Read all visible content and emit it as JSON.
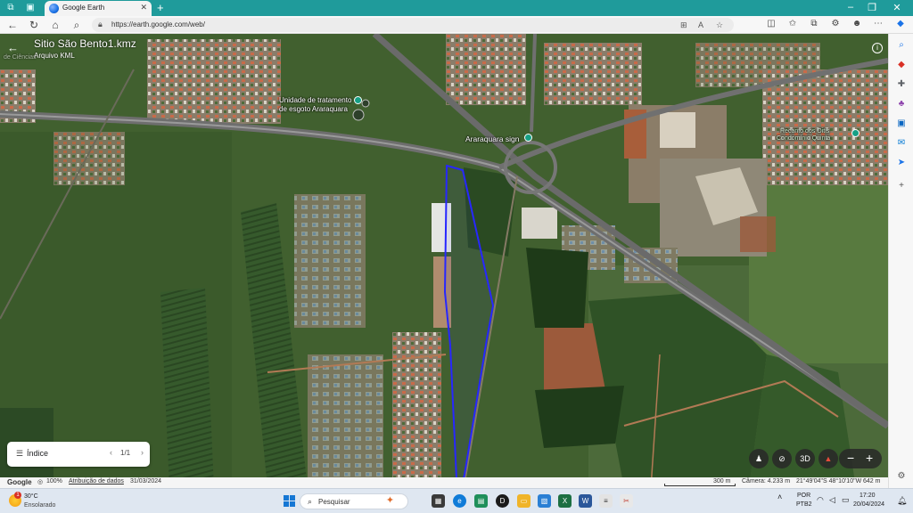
{
  "browser": {
    "tab_title": "Google Earth",
    "url": "https://earth.google.com/web/"
  },
  "earth": {
    "kml_title": "Sitio São Bento1.kmz",
    "kml_subtitle": "Arquivo KML",
    "labels": {
      "treatment_line1": "Unidade de tratamento",
      "treatment_line2": "de esgoto Araraquara",
      "sign": "Araraquara sign",
      "recanto_line1": "Recanto dos Oitis",
      "recanto_line2": "Condomínio Quinta",
      "topleft_faded": "de Ciências"
    },
    "index_panel": {
      "label": "Índice",
      "page": "1/1"
    },
    "controls": {
      "view_3d": "3D",
      "zoom_out": "−",
      "zoom_in": "+"
    },
    "polygon_color": "#2727ff"
  },
  "statusbar": {
    "brand": "Google",
    "zoom_pct": "100%",
    "attribution": "Atribuição de dados",
    "date": "31/03/2024",
    "scale": "300 m",
    "camera": "Câmera: 4.233 m",
    "coords": "21°49'04\"S 48°10'10\"W",
    "elevation": "642 m"
  },
  "taskbar": {
    "weather_temp": "30°C",
    "weather_cond": "Ensolarado",
    "weather_badge": "1",
    "search_placeholder": "Pesquisar",
    "lang_line1": "POR",
    "lang_line2": "PTB2",
    "time": "17:20",
    "date": "20/04/2024"
  }
}
